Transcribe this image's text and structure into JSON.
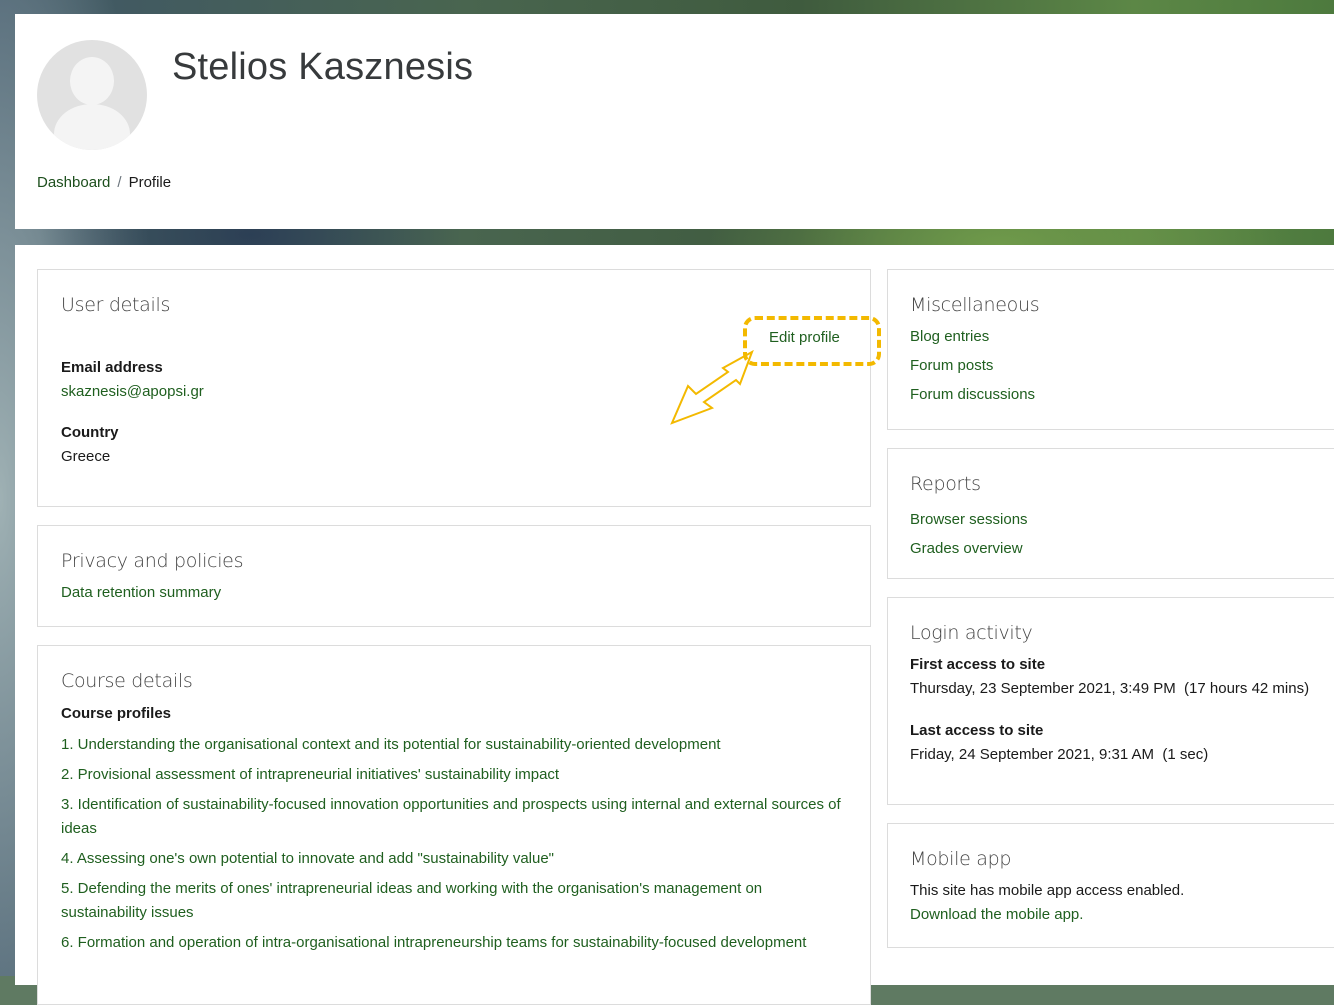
{
  "header": {
    "user_name": "Stelios Kasznesis",
    "breadcrumb": [
      {
        "label": "Dashboard"
      },
      {
        "label": "Profile"
      }
    ],
    "breadcrumb_separator": "/"
  },
  "user_details": {
    "title": "User details",
    "edit_profile": "Edit profile",
    "email_label": "Email address",
    "email_value": "skaznesis@apopsi.gr",
    "country_label": "Country",
    "country_value": "Greece",
    "highlight_color": "#f3b900"
  },
  "privacy": {
    "title": "Privacy and policies",
    "link": "Data retention summary"
  },
  "course_details": {
    "title": "Course details",
    "subtitle": "Course profiles",
    "courses": [
      "1. Understanding the organisational context and its potential for sustainability-oriented development",
      "2. Provisional assessment of intrapreneurial initiatives' sustainability impact",
      "3. Identification of sustainability-focused innovation opportunities and prospects using internal and external sources of ideas",
      "4. Assessing one's own potential to innovate and add \"sustainability value\"",
      "5. Defending the merits of ones' intrapreneurial ideas and working with the organisation's management on sustainability issues",
      "6. Formation and operation of intra-organisational intrapreneurship teams for sustainability-focused development"
    ]
  },
  "misc": {
    "title": "Miscellaneous",
    "links": [
      "Blog entries",
      "Forum posts",
      "Forum discussions"
    ]
  },
  "reports": {
    "title": "Reports",
    "links": [
      "Browser sessions",
      "Grades overview"
    ]
  },
  "login_activity": {
    "title": "Login activity",
    "first_label": "First access to site",
    "first_value": "Thursday, 23 September 2021, 3:49 PM  (17 hours 42 mins)",
    "last_label": "Last access to site",
    "last_value": "Friday, 24 September 2021, 9:31 AM  (1 sec)"
  },
  "mobile_app": {
    "title": "Mobile app",
    "text": "This site has mobile app access enabled.",
    "link": "Download the mobile app."
  },
  "colors": {
    "link": "#1f5f1f",
    "text": "#1a1a1a"
  }
}
